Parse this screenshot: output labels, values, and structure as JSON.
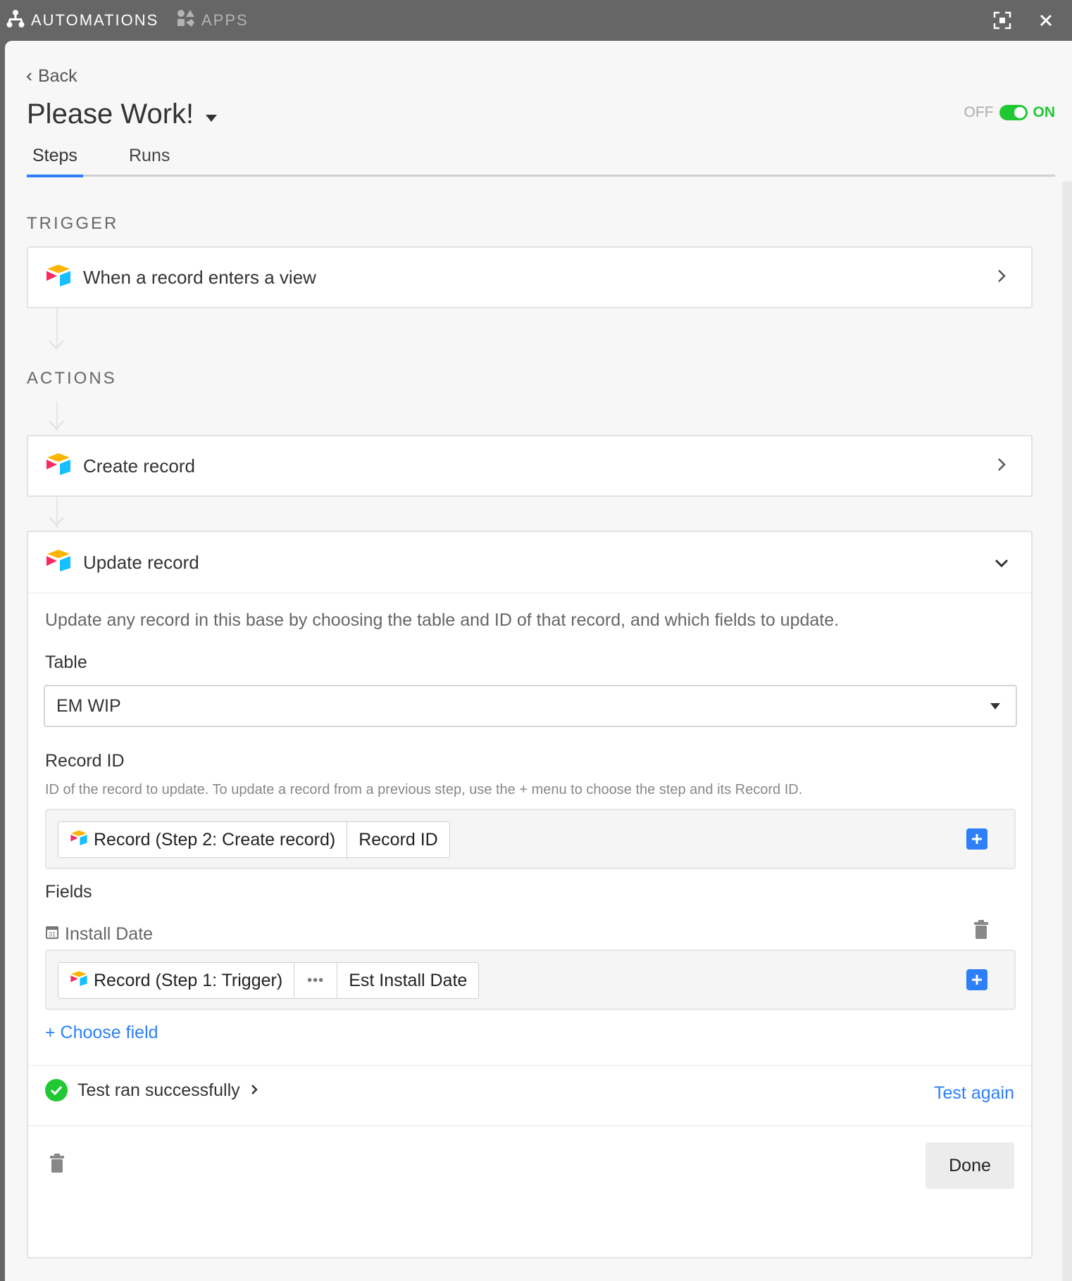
{
  "topbar": {
    "automations_label": "AUTOMATIONS",
    "apps_label": "APPS"
  },
  "header": {
    "back_label": "Back",
    "automation_name": "Please Work!",
    "toggle_off_label": "OFF",
    "toggle_on_label": "ON",
    "toggle_state": true
  },
  "tabs": [
    {
      "label": "Steps",
      "active": true
    },
    {
      "label": "Runs",
      "active": false
    }
  ],
  "trigger": {
    "section_label": "TRIGGER",
    "step_label": "When a record enters a view"
  },
  "actions": {
    "section_label": "ACTIONS",
    "create_step_label": "Create record",
    "update_step": {
      "label": "Update record",
      "description": "Update any record in this base by choosing the table and ID of that record, and which fields to update.",
      "table_label": "Table",
      "table_value": "EM WIP",
      "record_id_label": "Record ID",
      "record_id_hint": "ID of the record to update. To update a record from a previous step, use the + menu to choose the step and its Record ID.",
      "record_id_tokens": [
        "Record (Step 2: Create record)",
        "Record ID"
      ],
      "fields_label": "Fields",
      "field_name": "Install Date",
      "field_tokens": [
        "Record (Step 1: Trigger)",
        "•••",
        "Est Install Date"
      ],
      "choose_field_label": "+ Choose field",
      "test_status": "Test ran successfully",
      "test_again_label": "Test again",
      "done_label": "Done"
    }
  },
  "colors": {
    "accent_blue": "#2d7ff9",
    "success_green": "#20c933",
    "chrome_gray": "#666666"
  }
}
